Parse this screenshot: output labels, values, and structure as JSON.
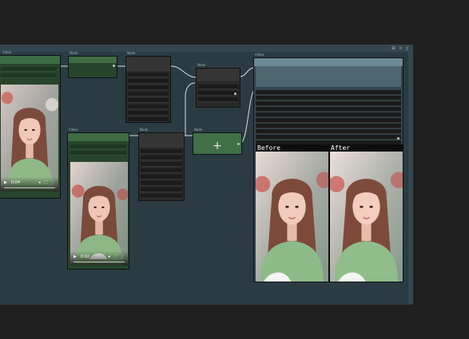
{
  "canvas": {
    "controls": [
      "⊕",
      "×",
      "◎"
    ]
  },
  "nodes": {
    "load_video": {
      "title": "Video",
      "duration": "0:04"
    },
    "green_small": {
      "title": "Node"
    },
    "list_a": {
      "title": "Node"
    },
    "upscale": {
      "title": "Node"
    },
    "preview_video": {
      "title": "Video",
      "duration": "0:02"
    },
    "list_b": {
      "title": "Node"
    },
    "add": {
      "title": "Node",
      "symbol": "+"
    },
    "compare": {
      "title": "Video",
      "before_label": "Before",
      "after_label": "After"
    }
  },
  "icons": {
    "play": "play-icon",
    "volume": "volume-icon",
    "fullscreen": "fullscreen-icon",
    "more": "more-icon"
  }
}
